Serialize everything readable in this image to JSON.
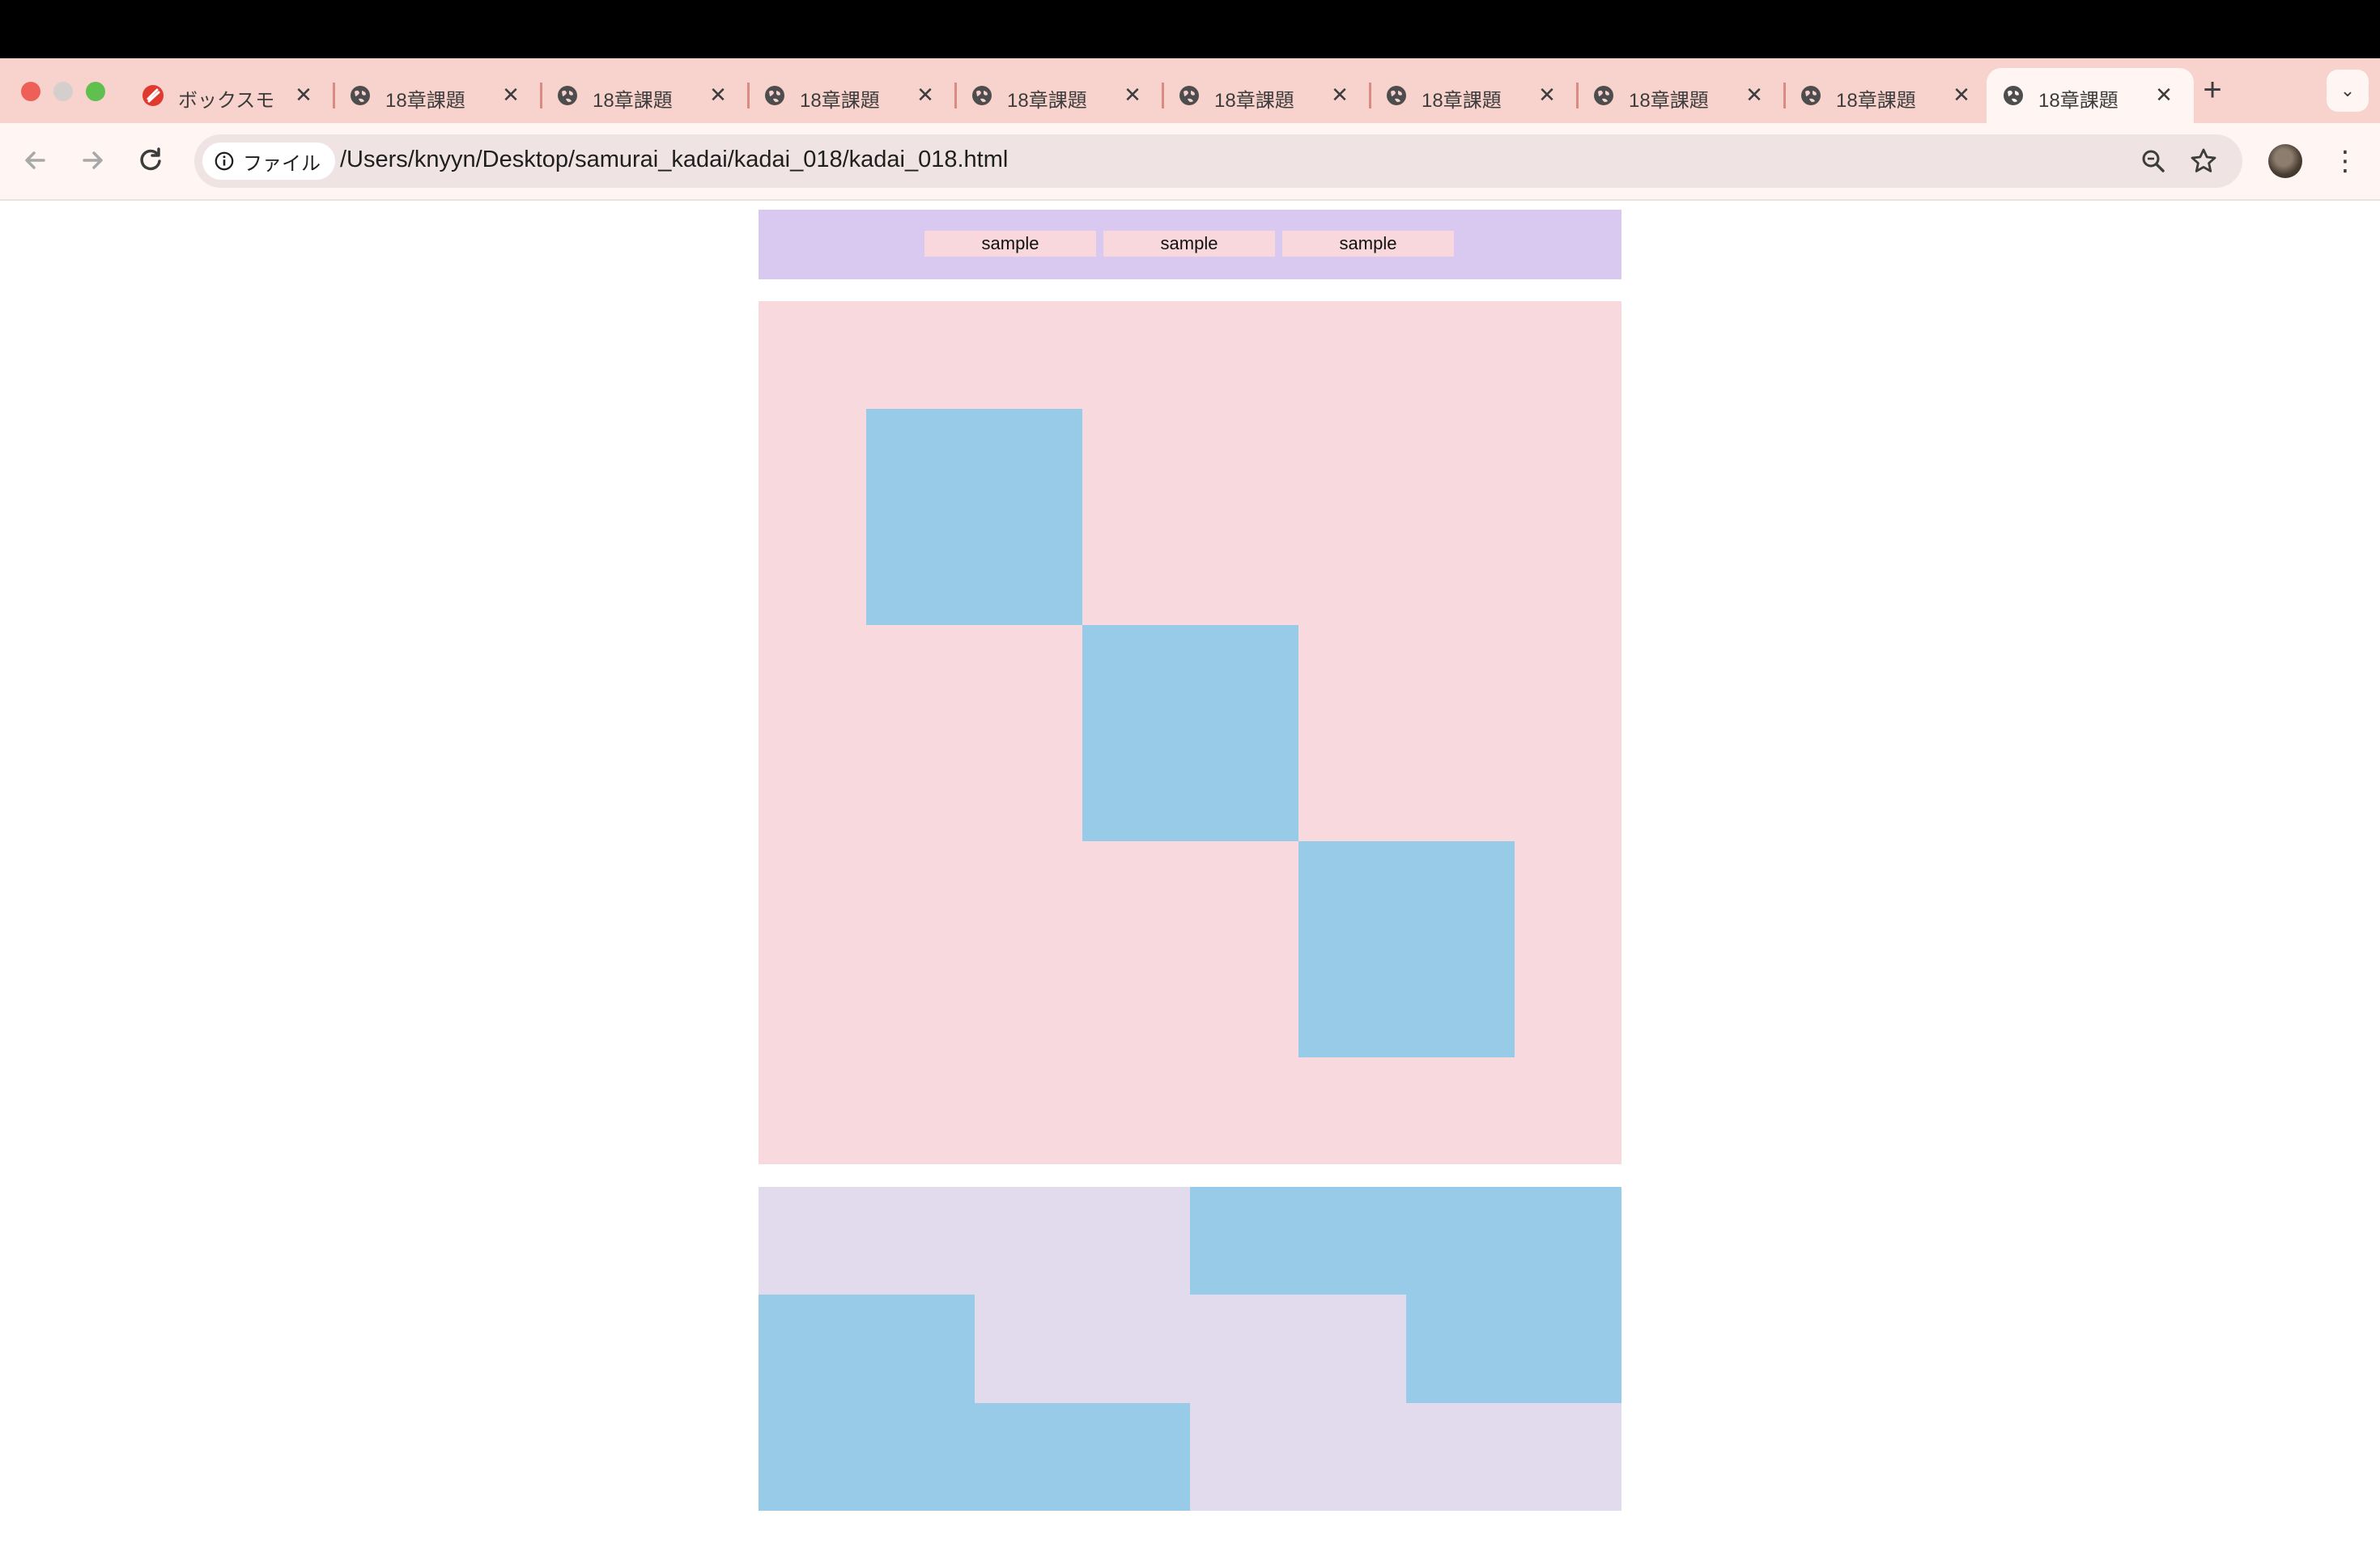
{
  "browser": {
    "tabs": [
      {
        "title": "ボックスモ",
        "favicon": "brand-icon",
        "active": false
      },
      {
        "title": "18章課題",
        "favicon": "globe-icon",
        "active": false
      },
      {
        "title": "18章課題",
        "favicon": "globe-icon",
        "active": false
      },
      {
        "title": "18章課題",
        "favicon": "globe-icon",
        "active": false
      },
      {
        "title": "18章課題",
        "favicon": "globe-icon",
        "active": false
      },
      {
        "title": "18章課題",
        "favicon": "globe-icon",
        "active": false
      },
      {
        "title": "18章課題",
        "favicon": "globe-icon",
        "active": false
      },
      {
        "title": "18章課題",
        "favicon": "globe-icon",
        "active": false
      },
      {
        "title": "18章課題",
        "favicon": "globe-icon",
        "active": false
      },
      {
        "title": "18章課題",
        "favicon": "globe-icon",
        "active": true
      }
    ],
    "address": {
      "chip_label": "ファイル",
      "url": "/Users/knyyn/Desktop/samurai_kadai/kadai_018/kadai_018.html"
    }
  },
  "page": {
    "nav_items": [
      "sample",
      "sample",
      "sample"
    ]
  },
  "colors": {
    "tabstrip": "#f8d3cd",
    "header_bg": "#d9c9f0",
    "nav_item_bg": "#f8d8dc",
    "main_bg": "#f8d9de",
    "block": "#97cbe8",
    "footer_bg": "#e2daed"
  }
}
